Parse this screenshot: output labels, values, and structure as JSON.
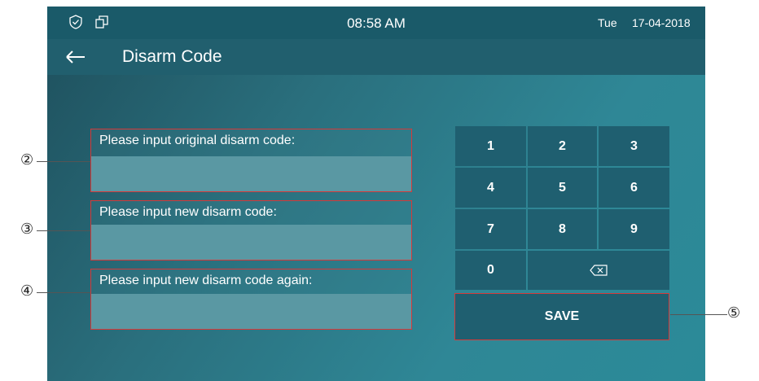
{
  "status_bar": {
    "time": "08:58 AM",
    "day": "Tue",
    "date": "17-04-2018",
    "icons": [
      "shield-icon",
      "copy-icon"
    ]
  },
  "header": {
    "back_icon": "back-arrow-icon",
    "title": "Disarm Code"
  },
  "form": {
    "fields": [
      {
        "label": "Please input original disarm code:",
        "value": ""
      },
      {
        "label": "Please input new disarm code:",
        "value": ""
      },
      {
        "label": "Please input new disarm code again:",
        "value": ""
      }
    ]
  },
  "keypad": {
    "keys": [
      "1",
      "2",
      "3",
      "4",
      "5",
      "6",
      "7",
      "8",
      "9",
      "0"
    ],
    "backspace_icon": "backspace-icon",
    "save_label": "SAVE"
  },
  "annotations": [
    "②",
    "③",
    "④",
    "⑤"
  ],
  "colors": {
    "status_bar": "#1a5a69",
    "title_bar": "#215f6e",
    "key": "#1f5f70",
    "input": "#5a98a3",
    "highlight": "#d43a3a"
  }
}
